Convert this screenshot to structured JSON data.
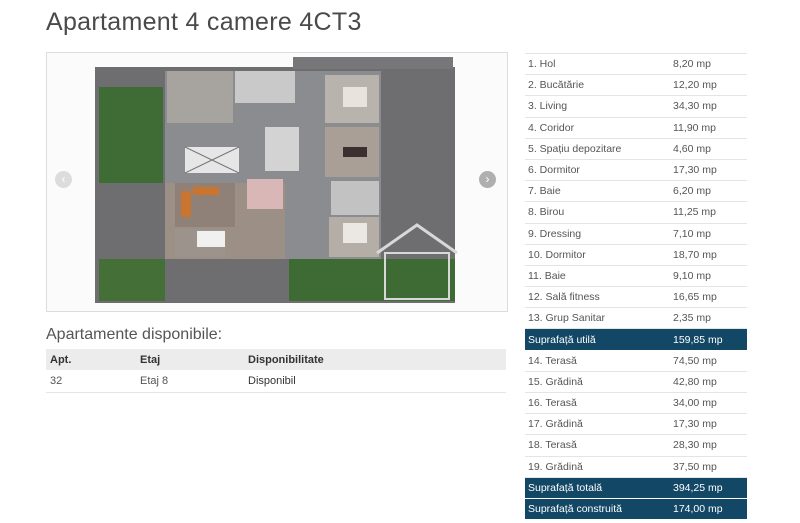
{
  "page": {
    "title": "Apartament 4 camere 4CT3"
  },
  "carousel": {
    "prev_label": "‹",
    "next_label": "›"
  },
  "available": {
    "heading": "Apartamente disponibile:",
    "columns": [
      "Apt.",
      "Etaj",
      "Disponibilitate"
    ],
    "rows": [
      {
        "apt": "32",
        "etaj": "Etaj 8",
        "status": "Disponibil"
      }
    ]
  },
  "areas": [
    {
      "name": "1. Hol",
      "value": "8,20 mp",
      "summary": false
    },
    {
      "name": "2. Bucătărie",
      "value": "12,20 mp",
      "summary": false
    },
    {
      "name": "3. Living",
      "value": "34,30 mp",
      "summary": false
    },
    {
      "name": "4. Coridor",
      "value": "11,90 mp",
      "summary": false
    },
    {
      "name": "5. Spațiu depozitare",
      "value": "4,60 mp",
      "summary": false
    },
    {
      "name": "6. Dormitor",
      "value": "17,30 mp",
      "summary": false
    },
    {
      "name": "7. Baie",
      "value": "6,20 mp",
      "summary": false
    },
    {
      "name": "8. Birou",
      "value": "11,25 mp",
      "summary": false
    },
    {
      "name": "9. Dressing",
      "value": "7,10 mp",
      "summary": false
    },
    {
      "name": "10. Dormitor",
      "value": "18,70 mp",
      "summary": false
    },
    {
      "name": "11. Baie",
      "value": "9,10 mp",
      "summary": false
    },
    {
      "name": "12. Sală fitness",
      "value": "16,65 mp",
      "summary": false
    },
    {
      "name": "13. Grup Sanitar",
      "value": "2,35 mp",
      "summary": false
    },
    {
      "name": "Suprafață utilă",
      "value": "159,85 mp",
      "summary": true
    },
    {
      "name": "14. Terasă",
      "value": "74,50 mp",
      "summary": false
    },
    {
      "name": "15. Grădină",
      "value": "42,80 mp",
      "summary": false
    },
    {
      "name": "16. Terasă",
      "value": "34,00 mp",
      "summary": false
    },
    {
      "name": "17. Grădină",
      "value": "17,30 mp",
      "summary": false
    },
    {
      "name": "18. Terasă",
      "value": "28,30 mp",
      "summary": false
    },
    {
      "name": "19. Grădină",
      "value": "37,50 mp",
      "summary": false
    },
    {
      "name": "Suprafață totală",
      "value": "394,25 mp",
      "summary": true
    },
    {
      "name": "Suprafață construită",
      "value": "174,00 mp",
      "summary": true
    }
  ],
  "colors": {
    "summary_bg": "#134766",
    "grass": "#3f6b34",
    "terrace": "#6e6e70"
  }
}
